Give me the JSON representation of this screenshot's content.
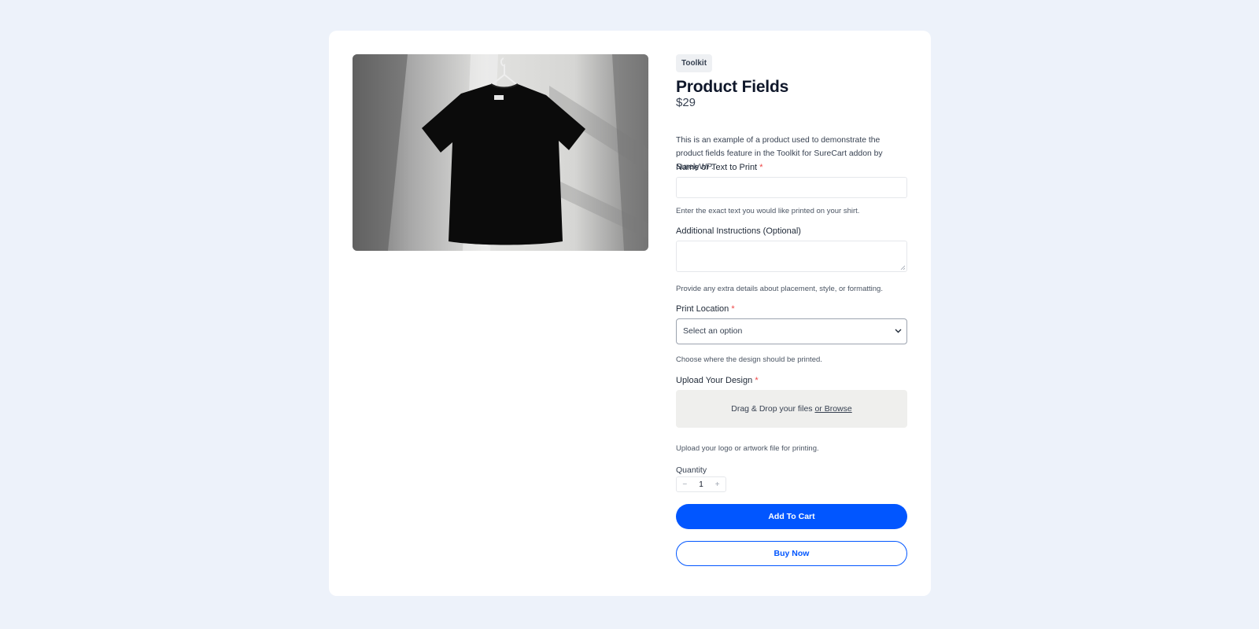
{
  "product": {
    "badge": "Toolkit",
    "title": "Product Fields",
    "price": "$29",
    "description": "This is an example of a product used to demonstrate the product fields feature in the Toolkit for SureCart addon by SurelyWP.",
    "image_icon": "black-tshirt-on-hanger"
  },
  "fields": {
    "name_text": {
      "label": "Name or Text to Print",
      "required_mark": "*",
      "value": "",
      "help": "Enter the exact text you would like printed on your shirt."
    },
    "instructions": {
      "label": "Additional Instructions (Optional)",
      "value": "",
      "help": "Provide any extra details about placement, style, or formatting."
    },
    "print_location": {
      "label": "Print Location",
      "required_mark": "*",
      "selected": "Select an option",
      "help": "Choose where the design should be printed."
    },
    "upload": {
      "label": "Upload Your Design",
      "required_mark": "*",
      "drop_text": "Drag & Drop your files",
      "browse_text": "or Browse",
      "help": "Upload your logo or artwork file for printing."
    }
  },
  "quantity": {
    "label": "Quantity",
    "minus": "−",
    "value": "1",
    "plus": "+"
  },
  "actions": {
    "add_to_cart": "Add To Cart",
    "buy_now": "Buy Now"
  },
  "colors": {
    "page_bg": "#edf2fa",
    "accent": "#0156ff",
    "required": "#ef4444"
  }
}
